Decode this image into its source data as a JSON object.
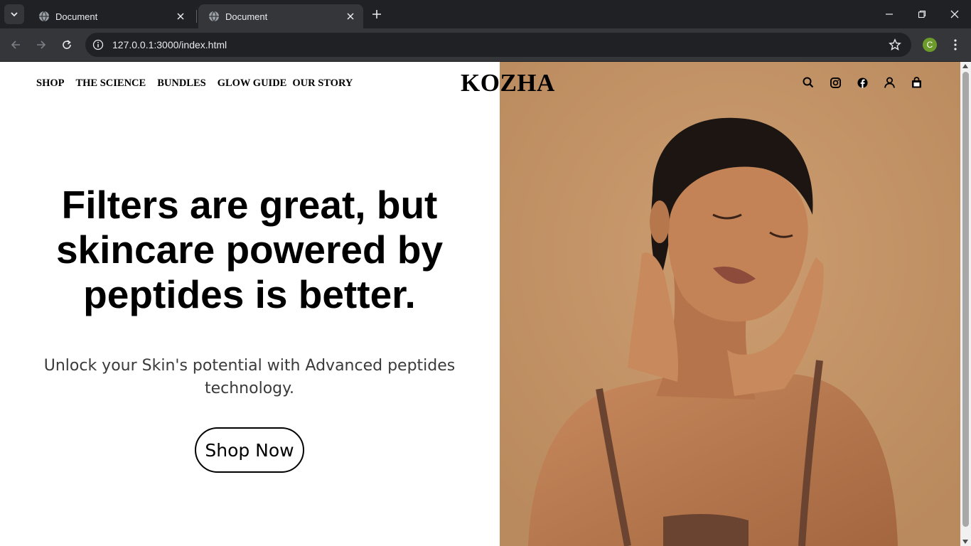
{
  "browser": {
    "tabs": [
      {
        "title": "Document",
        "active": false
      },
      {
        "title": "Document",
        "active": true
      }
    ],
    "url": "127.0.0.1:3000/index.html",
    "profile_initial": "C",
    "profile_color": "#6c9a2b"
  },
  "site": {
    "nav": [
      "SHOP",
      "THE SCIENCE",
      "BUNDLES",
      "GLOW GUIDE",
      "OUR STORY"
    ],
    "logo": "KOZHA",
    "icons": [
      "search-icon",
      "instagram-icon",
      "facebook-icon",
      "account-icon",
      "bag-icon"
    ],
    "hero": {
      "headline": "Filters are great, but skincare powered by peptides is better.",
      "subtext": "Unlock your Skin's potential with Advanced peptides technology.",
      "cta_label": "Shop Now",
      "image_bg_color": "#c29366"
    }
  }
}
